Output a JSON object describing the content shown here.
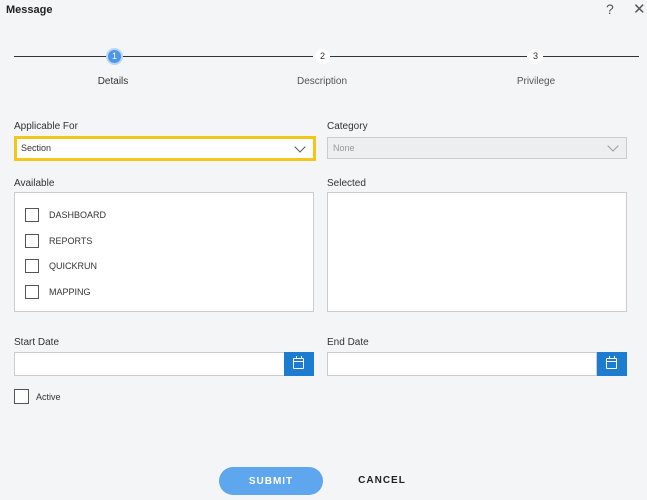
{
  "window": {
    "title": "Message",
    "help_glyph": "?",
    "close_glyph": "✕"
  },
  "stepper": {
    "steps": [
      {
        "number": "1",
        "label": "Details",
        "active": true
      },
      {
        "number": "2",
        "label": "Description",
        "active": false
      },
      {
        "number": "3",
        "label": "Privilege",
        "active": false
      }
    ]
  },
  "form": {
    "applicable_for": {
      "label": "Applicable For",
      "value": "Section"
    },
    "category": {
      "label": "Category",
      "value": "None",
      "disabled": true
    },
    "available": {
      "label": "Available",
      "items": [
        "DASHBOARD",
        "REPORTS",
        "QUICKRUN",
        "MAPPING"
      ]
    },
    "selected": {
      "label": "Selected",
      "items": []
    },
    "start_date": {
      "label": "Start Date",
      "value": ""
    },
    "end_date": {
      "label": "End Date",
      "value": ""
    },
    "active": {
      "label": "Active",
      "checked": false
    }
  },
  "actions": {
    "submit_label": "SUBMIT",
    "cancel_label": "CANCEL"
  },
  "colors": {
    "accent": "#1d7ccf",
    "submit": "#5ea6ee",
    "highlight_border": "#f5c518",
    "step_active": "#4d97e6"
  }
}
